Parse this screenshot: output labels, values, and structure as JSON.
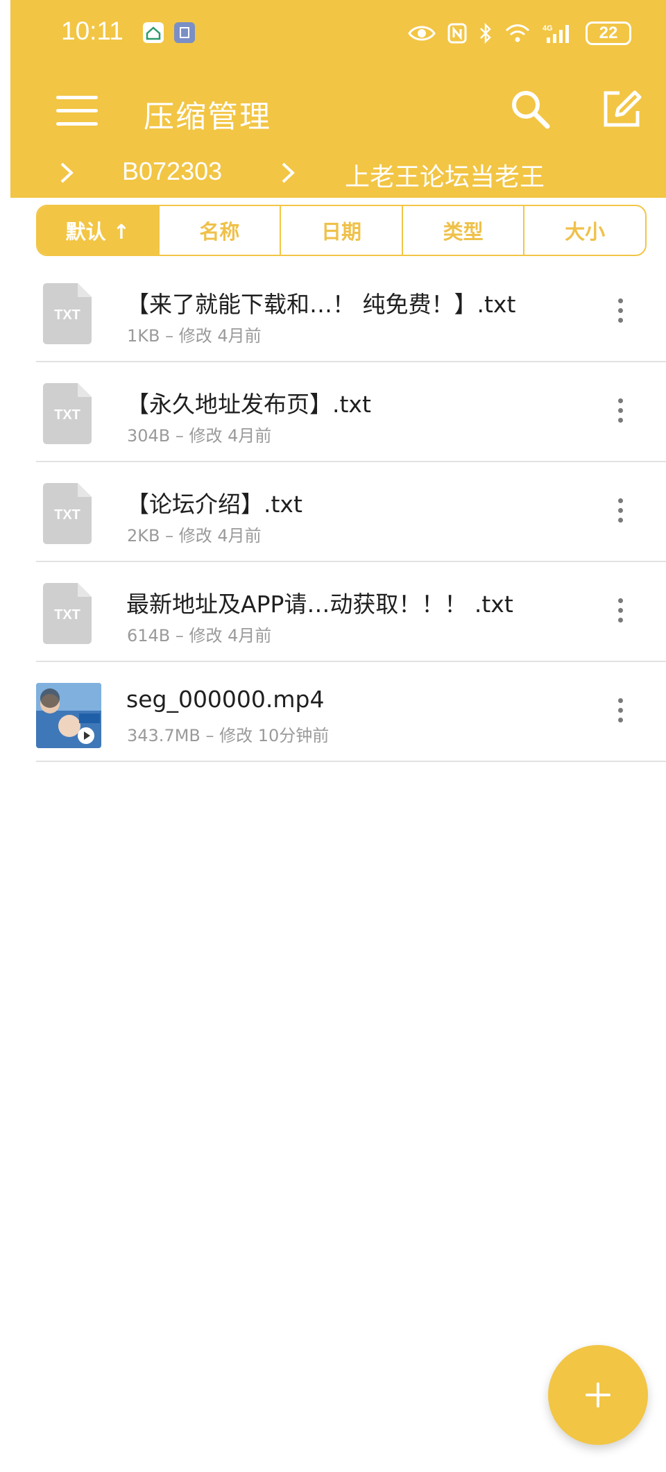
{
  "status_bar": {
    "time": "10:11",
    "battery": "22",
    "icons": [
      "home-app-icon",
      "app-badge-icon",
      "eye-icon",
      "nfc-icon",
      "bluetooth-icon",
      "wifi-icon",
      "signal-4g-icon",
      "battery-icon"
    ]
  },
  "toolbar": {
    "title": "压缩管理",
    "icons": [
      "menu-icon",
      "search-icon",
      "edit-icon"
    ]
  },
  "breadcrumb": {
    "items": [
      "B072303",
      "上老王论坛当老王"
    ]
  },
  "sort_tabs": [
    {
      "label": "默认 ↑",
      "active": true
    },
    {
      "label": "名称",
      "active": false
    },
    {
      "label": "日期",
      "active": false
    },
    {
      "label": "类型",
      "active": false
    },
    {
      "label": "大小",
      "active": false
    }
  ],
  "files": [
    {
      "name": "【来了就能下载和…！ 纯免费！】.txt",
      "meta": "1KB – 修改 4月前",
      "icon_label": "TXT",
      "type": "txt"
    },
    {
      "name": "【永久地址发布页】.txt",
      "meta": "304B – 修改 4月前",
      "icon_label": "TXT",
      "type": "txt"
    },
    {
      "name": "【论坛介绍】.txt",
      "meta": "2KB – 修改 4月前",
      "icon_label": "TXT",
      "type": "txt"
    },
    {
      "name": "最新地址及APP请…动获取！！！ .txt",
      "meta": "614B – 修改 4月前",
      "icon_label": "TXT",
      "type": "txt"
    },
    {
      "name": "seg_000000.mp4",
      "meta": "343.7MB – 修改 10分钟前",
      "icon_label": "",
      "type": "video"
    }
  ],
  "fab": {
    "icon": "plus-icon"
  },
  "colors": {
    "accent": "#f2c544",
    "divider": "#e2e2e2",
    "meta_text": "#9a9a9a",
    "file_icon": "#cfcfcf"
  }
}
